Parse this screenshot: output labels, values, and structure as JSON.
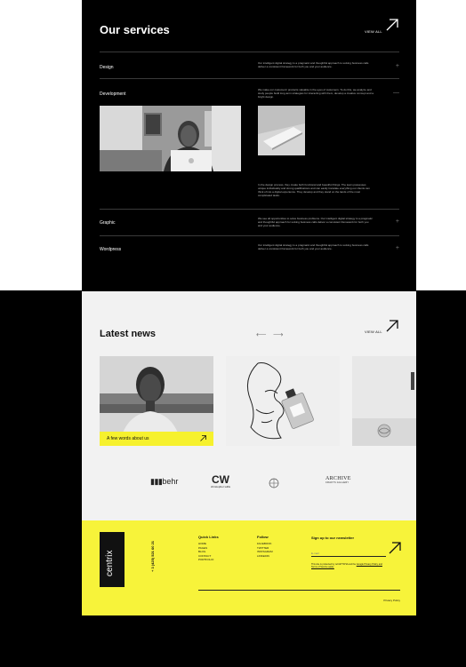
{
  "services": {
    "title": "Our services",
    "view_all": "VIEW ALL",
    "items": [
      {
        "name": "Design",
        "description": "Our intelligent digital strategy is a pragmatic and thoughtful approach to solving business calls deliver a consistent framework for both you and your audience.",
        "toggle": "+"
      },
      {
        "name": "Development",
        "description": "We make our customers' products valuable in the eyes of customers. To do this, we analyze and study people build long-term strategies for interacting with them, develop a creative concept and a bright design.",
        "toggle": "—"
      },
      {
        "name": "Graphic",
        "description": "We see all opportunities to solve business problems. Our intelligent digital strategy is a pragmatic and thoughtful approach for solving business calls deliver a consistent framework for both you and your audience.",
        "toggle": "+"
      },
      {
        "name": "Wordpress",
        "description": "Our intelligent digital strategy is a pragmatic and thoughtful approach to solving business calls deliver a consistent framework for both you and your audience.",
        "toggle": "+"
      }
    ],
    "development_detail": "In the design process, they create both functional and beautiful things. The team possesses unique individuality and strong qualifications and can easily translate everything our clients can think of into a digital experience. They develop and they stand on the lands of the most complicated tasks."
  },
  "news": {
    "title": "Latest news",
    "prev_arrow": "⟵",
    "next_arrow": "⟶",
    "view_all": "VIEW ALL",
    "cards": [
      {
        "caption": "A few words about us"
      }
    ]
  },
  "logos": [
    {
      "name": "behr",
      "text": "behr",
      "subtext": ""
    },
    {
      "name": "christopher-wills",
      "text": "CW",
      "subtext": "christopher willis"
    },
    {
      "name": "compass",
      "text": "",
      "subtext": ""
    },
    {
      "name": "archive",
      "text": "ARCHIVE",
      "subtext": "CRAFTS GALLERY"
    }
  ],
  "footer": {
    "brand": "centrix",
    "phone": "+ 3 (425) 521 60 21",
    "quick_links": {
      "heading": "Quick Links",
      "links": [
        "HOME",
        "PAGES",
        "BLOG",
        "CONTACT",
        "PORTFOLIO"
      ]
    },
    "follow": {
      "heading": "Follow",
      "links": [
        "FACEBOOK",
        "TWITTER",
        "INSTAGRAM",
        "LINKEDIN"
      ]
    },
    "newsletter": {
      "heading": "Sign up to our newsletter",
      "placeholder": "E-mail",
      "consent_prefix": "This site is protected by reCAPTCHA and the",
      "consent_links": "Google Privacy Policy and Terms of Service apply."
    },
    "privacy": "Privacy Policy"
  },
  "colors": {
    "accent_yellow": "#f7f33a",
    "dark": "#000000",
    "light_bg": "#f2f2f2"
  }
}
